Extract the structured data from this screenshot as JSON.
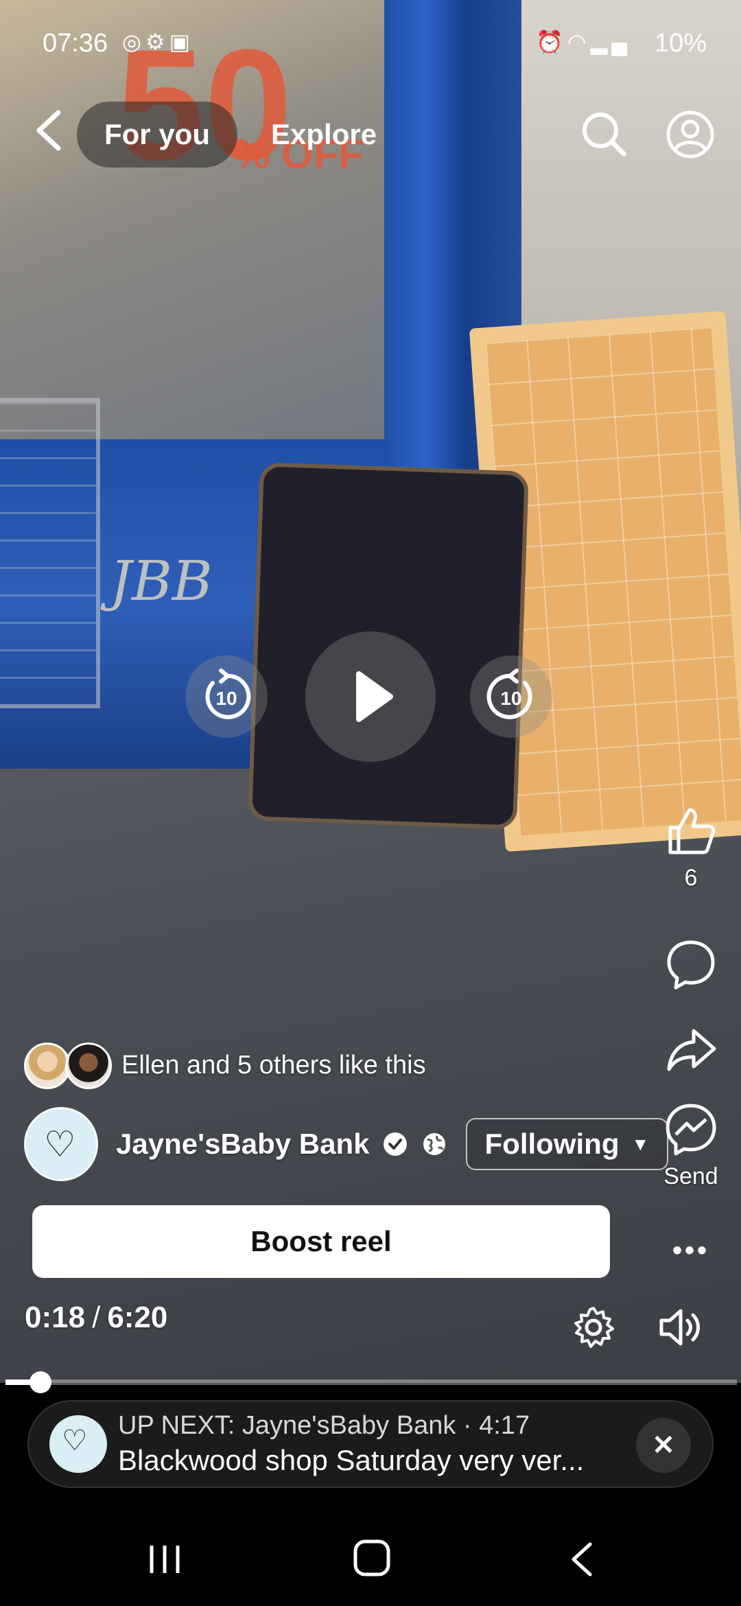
{
  "status_bar": {
    "time": "07:36",
    "battery": "10%",
    "icons_left": [
      "instagram-icon",
      "settings-icon",
      "notification-icon"
    ],
    "icons_right": [
      "alarm-icon",
      "wifi-icon",
      "signal-icon"
    ]
  },
  "top_nav": {
    "tabs": [
      {
        "label": "For you",
        "active": true
      },
      {
        "label": "Explore",
        "active": false
      }
    ]
  },
  "player": {
    "rewind_seconds": "10",
    "forward_seconds": "10"
  },
  "right_rail": {
    "like_count": "6",
    "send_label": "Send"
  },
  "reel": {
    "likes_text": "Ellen and 5 others like this",
    "page_name": "Jayne'sBaby Bank",
    "follow_label": "Following",
    "boost_label": "Boost reel",
    "current_time": "0:18",
    "time_separator": "/",
    "duration": "6:20",
    "progress_fraction": 0.048
  },
  "up_next": {
    "line1": "UP NEXT: Jayne'sBaby Bank · 4:17",
    "line2": "Blackwood  shop Saturday very ver..."
  },
  "colors": {
    "accent_blue": "#1f4fa8",
    "up_next_bg": "#1b1b1b",
    "boost_bg": "#ffffff"
  }
}
